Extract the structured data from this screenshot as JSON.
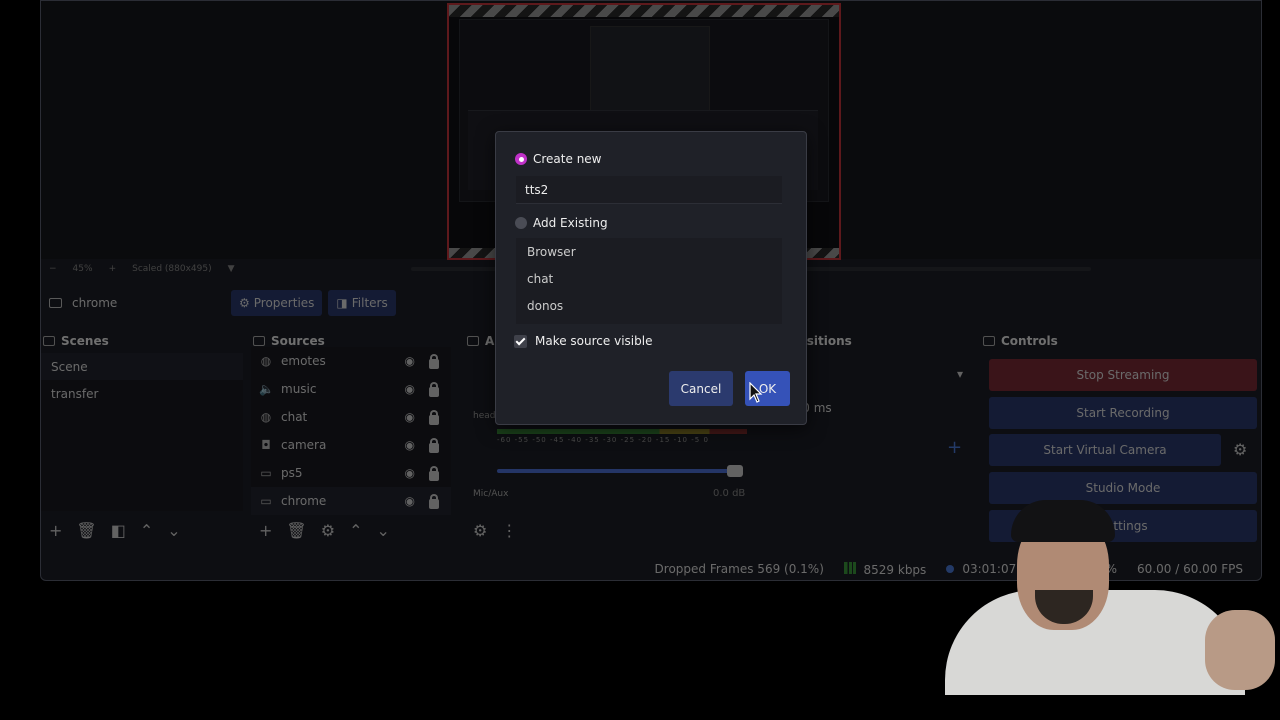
{
  "app": {
    "zoom": "45%",
    "scaled_label": "Scaled (880x495)",
    "current_source": "chrome",
    "properties_label": "Properties",
    "filters_label": "Filters"
  },
  "docks": {
    "scenes": {
      "title": "Scenes",
      "items": [
        "Scene",
        "transfer"
      ]
    },
    "sources": {
      "title": "Sources",
      "items": [
        {
          "name": "emotes",
          "icon": "globe-icon"
        },
        {
          "name": "music",
          "icon": "speaker-icon"
        },
        {
          "name": "chat",
          "icon": "globe-icon"
        },
        {
          "name": "camera",
          "icon": "camera-icon"
        },
        {
          "name": "ps5",
          "icon": "monitor-icon"
        },
        {
          "name": "chrome",
          "icon": "monitor-icon"
        }
      ]
    },
    "mixer": {
      "title": "Au",
      "headset_label": "heads",
      "ticks": "-60 -55 -50 -45 -40 -35 -30 -25 -20 -15 -10 -5 0",
      "mic_label": "Mic/Aux",
      "mic_db": "0.0 dB"
    },
    "transitions": {
      "title": "e Transitions",
      "duration_prefix": "n",
      "duration": "300 ms"
    },
    "controls": {
      "title": "Controls",
      "stop_streaming": "Stop Streaming",
      "start_recording": "Start Recording",
      "start_virtual_camera": "Start Virtual Camera",
      "studio_mode": "Studio Mode",
      "settings": "Settings"
    }
  },
  "status": {
    "dropped_frames": "Dropped Frames 569 (0.1%)",
    "bitrate": "8529 kbps",
    "stream_time": "03:01:07",
    "cpu": "5%",
    "fps": "60.00 / 60.00 FPS"
  },
  "dialog": {
    "create_new_label": "Create new",
    "name_value": "tts2",
    "add_existing_label": "Add Existing",
    "existing_sources": [
      "Browser",
      "chat",
      "donos"
    ],
    "make_visible_label": "Make source visible",
    "cancel_label": "Cancel",
    "ok_label": "OK"
  },
  "colors": {
    "accent": "#3552b8",
    "radio_selected": "#c031c8",
    "stop_streaming": "#7a2a36",
    "preview_border": "#c4363c"
  }
}
